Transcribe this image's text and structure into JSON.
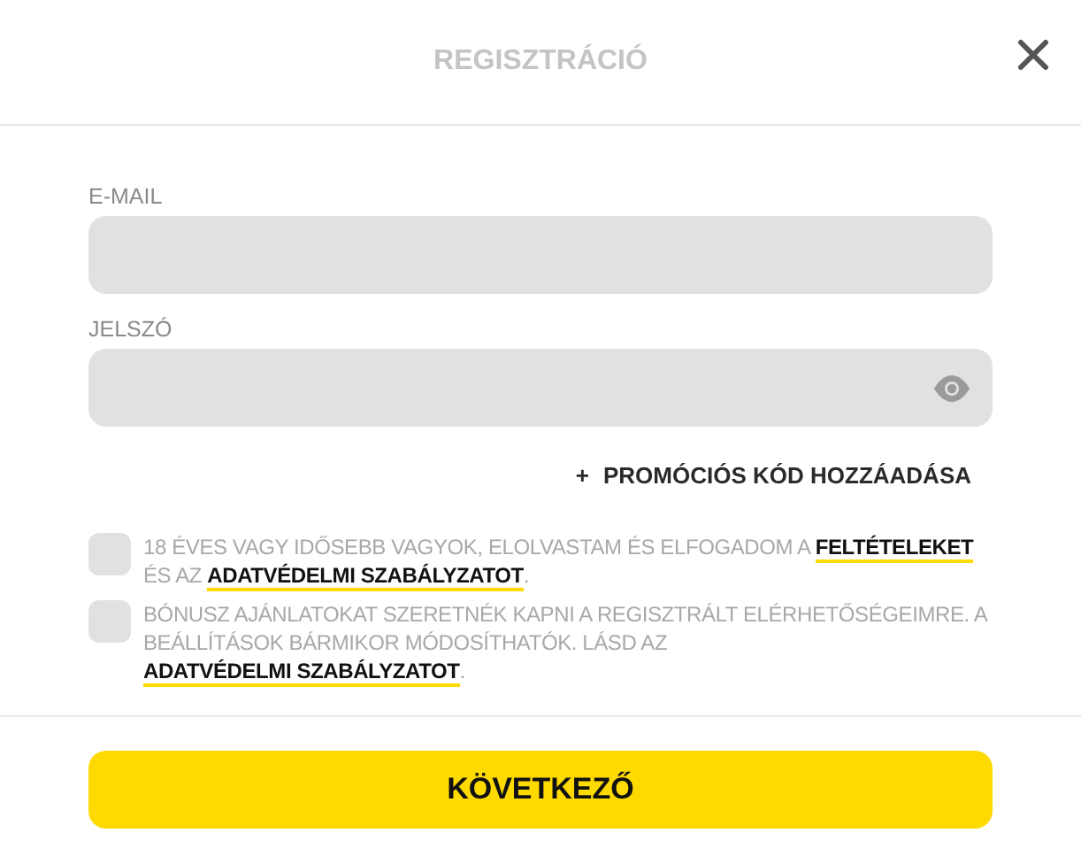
{
  "title": "REGISZTRÁCIÓ",
  "fields": [
    {
      "label": "E-MAIL",
      "kind": "text"
    },
    {
      "label": "JELSZÓ",
      "kind": "password"
    }
  ],
  "promo_link": {
    "icon": "+",
    "label": "PROMÓCIÓS KÓD HOZZÁADÁSA"
  },
  "consents": [
    {
      "checked": false,
      "parts": [
        {
          "kind": "text",
          "text": "18 ÉVES VAGY IDŐSEBB VAGYOK, ELOLVASTAM ÉS ELFOGADOM A "
        },
        {
          "kind": "link",
          "text": "FELTÉTELEKET"
        },
        {
          "kind": "text",
          "text": " ÉS AZ "
        },
        {
          "kind": "link",
          "text": "ADATVÉDELMI SZABÁLYZATOT"
        },
        {
          "kind": "text",
          "text": "."
        }
      ]
    },
    {
      "checked": false,
      "parts": [
        {
          "kind": "text",
          "text": "BÓNUSZ AJÁNLATOKAT SZERETNÉK KAPNI A REGISZTRÁLT ELÉRHETŐSÉGEIMRE. A BEÁLLÍTÁSOK BÁRMIKOR MÓDOSÍTHATÓK. LÁSD AZ "
        },
        {
          "kind": "link",
          "text": "ADATVÉDELMI SZABÁLYZATOT"
        },
        {
          "kind": "text",
          "text": "."
        }
      ]
    }
  ],
  "next_button": "KÖVETKEZŐ"
}
